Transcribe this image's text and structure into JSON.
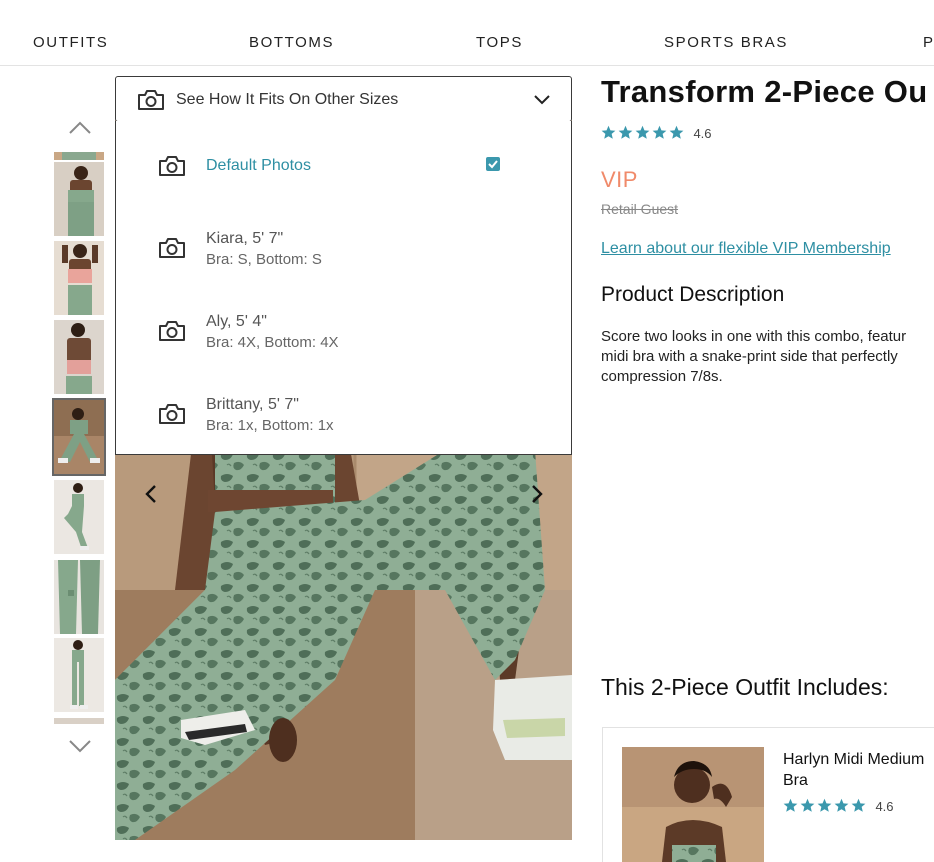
{
  "nav": {
    "items": [
      {
        "label": "OUTFITS"
      },
      {
        "label": "BOTTOMS"
      },
      {
        "label": "TOPS"
      },
      {
        "label": "SPORTS BRAS"
      },
      {
        "label": "P"
      }
    ]
  },
  "size_selector": {
    "label": "See How It Fits On Other Sizes",
    "options": [
      {
        "name": "Default Photos",
        "detail": "",
        "selected": true
      },
      {
        "name": "Kiara, 5' 7\"",
        "detail": "Bra: S, Bottom: S",
        "selected": false
      },
      {
        "name": "Aly, 5' 4\"",
        "detail": "Bra: 4X, Bottom: 4X",
        "selected": false
      },
      {
        "name": "Brittany, 5' 7\"",
        "detail": "Bra: 1x, Bottom: 1x",
        "selected": false
      }
    ]
  },
  "product": {
    "title": "Transform 2-Piece Ou",
    "rating": "4.6",
    "stars": 5,
    "vip_label": "VIP",
    "retail_label": "Retail Guest",
    "vip_link": "Learn about our flexible VIP Membership",
    "description_heading": "Product Description",
    "description_lines": [
      "Score two looks in one with this combo, featur",
      "midi bra with a snake-print side that perfectly",
      "compression 7/8s."
    ]
  },
  "includes": {
    "heading": "This 2-Piece Outfit Includes:",
    "items": [
      {
        "name_lines": [
          "Harlyn Midi Medium",
          "Bra"
        ],
        "rating": "4.6",
        "stars": 5
      }
    ]
  },
  "colors": {
    "accent": "#2e8fa3",
    "star": "#3b98ad",
    "vip": "#f08a6a"
  }
}
